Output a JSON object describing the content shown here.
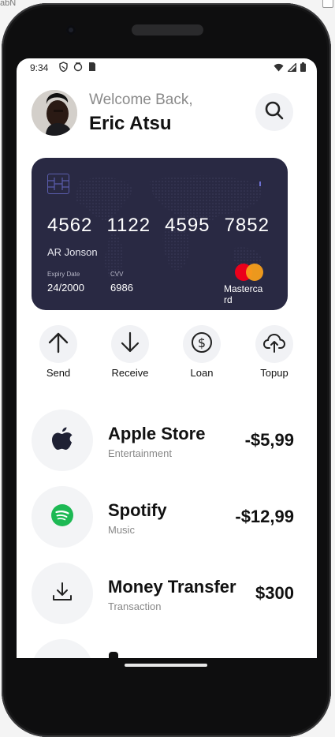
{
  "browser_fragment": "abN",
  "status_bar": {
    "time": "9:34"
  },
  "header": {
    "welcome": "Welcome Back,",
    "user_name": "Eric Atsu"
  },
  "card": {
    "number_groups": [
      "4562",
      "1122",
      "4595",
      "7852"
    ],
    "holder_name": "AR Jonson",
    "expiry_label": "Expiry Date",
    "expiry_value": "24/2000",
    "cvv_label": "CVV",
    "cvv_value": "6986",
    "brand": "Mastercard",
    "colors": {
      "background": "#292943",
      "mc_red": "#eb001b",
      "mc_orange": "#f79e1b"
    }
  },
  "actions": [
    {
      "label": "Send",
      "icon": "arrow-up-icon"
    },
    {
      "label": "Receive",
      "icon": "arrow-down-icon"
    },
    {
      "label": "Loan",
      "icon": "dollar-circle-icon"
    },
    {
      "label": "Topup",
      "icon": "cloud-upload-icon"
    }
  ],
  "transactions": [
    {
      "title": "Apple Store",
      "subtitle": "Entertainment",
      "amount": "-$5,99",
      "icon": "apple-icon"
    },
    {
      "title": "Spotify",
      "subtitle": "Music",
      "amount": "-$12,99",
      "icon": "spotify-icon"
    },
    {
      "title": "Money Transfer",
      "subtitle": "Transaction",
      "amount": "$300",
      "icon": "download-icon"
    }
  ]
}
